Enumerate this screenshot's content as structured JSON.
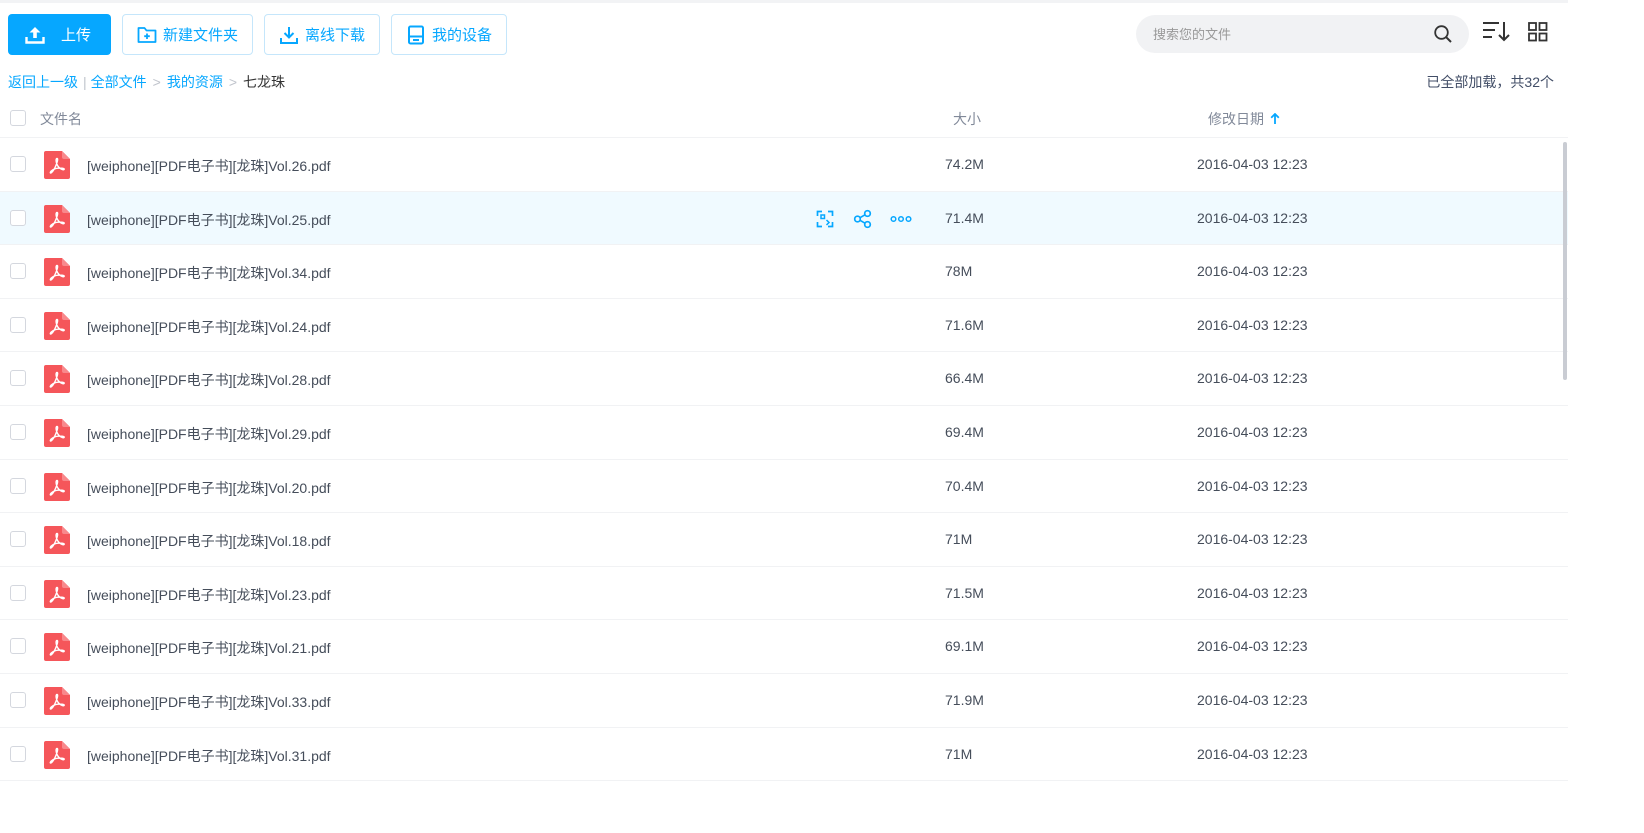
{
  "colors": {
    "accent": "#06a7ff",
    "pdf_red": "#f5565a",
    "text": "#454d5a",
    "muted": "#818999"
  },
  "toolbar": {
    "upload_label": "上传",
    "new_folder_label": "新建文件夹",
    "offline_download_label": "离线下载",
    "my_devices_label": "我的设备"
  },
  "search": {
    "placeholder": "搜索您的文件"
  },
  "breadcrumb": {
    "back_label": "返回上一级",
    "items": [
      "全部文件",
      "我的资源",
      "七龙珠"
    ]
  },
  "status": {
    "loaded_text": "已全部加载，共32个"
  },
  "table": {
    "columns": {
      "name": "文件名",
      "size": "大小",
      "date": "修改日期"
    },
    "sort": {
      "column": "date",
      "direction": "ascending"
    },
    "hovered_row_index": 1,
    "rows": [
      {
        "name": "[weiphone][PDF电子书][龙珠]Vol.26.pdf",
        "size": "74.2M",
        "date": "2016-04-03 12:23",
        "icon": "pdf-icon"
      },
      {
        "name": "[weiphone][PDF电子书][龙珠]Vol.25.pdf",
        "size": "71.4M",
        "date": "2016-04-03 12:23",
        "icon": "pdf-icon"
      },
      {
        "name": "[weiphone][PDF电子书][龙珠]Vol.34.pdf",
        "size": "78M",
        "date": "2016-04-03 12:23",
        "icon": "pdf-icon"
      },
      {
        "name": "[weiphone][PDF电子书][龙珠]Vol.24.pdf",
        "size": "71.6M",
        "date": "2016-04-03 12:23",
        "icon": "pdf-icon"
      },
      {
        "name": "[weiphone][PDF电子书][龙珠]Vol.28.pdf",
        "size": "66.4M",
        "date": "2016-04-03 12:23",
        "icon": "pdf-icon"
      },
      {
        "name": "[weiphone][PDF电子书][龙珠]Vol.29.pdf",
        "size": "69.4M",
        "date": "2016-04-03 12:23",
        "icon": "pdf-icon"
      },
      {
        "name": "[weiphone][PDF电子书][龙珠]Vol.20.pdf",
        "size": "70.4M",
        "date": "2016-04-03 12:23",
        "icon": "pdf-icon"
      },
      {
        "name": "[weiphone][PDF电子书][龙珠]Vol.18.pdf",
        "size": "71M",
        "date": "2016-04-03 12:23",
        "icon": "pdf-icon"
      },
      {
        "name": "[weiphone][PDF电子书][龙珠]Vol.23.pdf",
        "size": "71.5M",
        "date": "2016-04-03 12:23",
        "icon": "pdf-icon"
      },
      {
        "name": "[weiphone][PDF电子书][龙珠]Vol.21.pdf",
        "size": "69.1M",
        "date": "2016-04-03 12:23",
        "icon": "pdf-icon"
      },
      {
        "name": "[weiphone][PDF电子书][龙珠]Vol.33.pdf",
        "size": "71.9M",
        "date": "2016-04-03 12:23",
        "icon": "pdf-icon"
      },
      {
        "name": "[weiphone][PDF电子书][龙珠]Vol.31.pdf",
        "size": "71M",
        "date": "2016-04-03 12:23",
        "icon": "pdf-icon"
      }
    ]
  },
  "row_actions": [
    "convert-icon",
    "share-icon",
    "more-icon"
  ]
}
